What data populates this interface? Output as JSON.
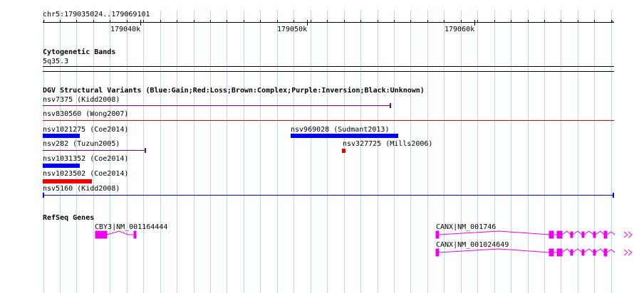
{
  "ruler": {
    "region": "chr5:179035024..179069101",
    "ticks": [
      "179040k",
      "179050k",
      "179060k"
    ]
  },
  "cytogenetic": {
    "title": "Cytogenetic Bands",
    "band": "5q35.3"
  },
  "dgv": {
    "title": "DGV Structural Variants (Blue:Gain;Red:Loss;Brown:Complex;Purple:Inversion;Black:Unknown)",
    "variants": [
      {
        "label": "nsv7375 (Kidd2008)",
        "type": "Purple"
      },
      {
        "label": "nsv830560 (Wong2007)",
        "type": "Red"
      },
      {
        "label": "nsv1021275 (Coe2014)",
        "type": "Blue"
      },
      {
        "label": "nsv969028 (Sudmant2013)",
        "type": "Blue"
      },
      {
        "label": "nsv282 (Tuzun2005)",
        "type": "Purple"
      },
      {
        "label": "nsv327725 (Mills2006)",
        "type": "Red"
      },
      {
        "label": "nsv1031352 (Coe2014)",
        "type": "Blue"
      },
      {
        "label": "nsv1023502 (Coe2014)",
        "type": "Red"
      },
      {
        "label": "nsv5160 (Kidd2008)",
        "type": "Blue"
      }
    ]
  },
  "refseq": {
    "title": "RefSeq Genes",
    "genes": [
      {
        "label": "CBY3|NM_001164444"
      },
      {
        "label": "CANX|NM_001746"
      },
      {
        "label": "CANX|NM_001024649"
      }
    ]
  },
  "colors": {
    "grid": "#b3dde8",
    "gain": "#0000ee",
    "loss": "#ee0000",
    "inversion": "#800080",
    "gene": "#ee00ee"
  }
}
